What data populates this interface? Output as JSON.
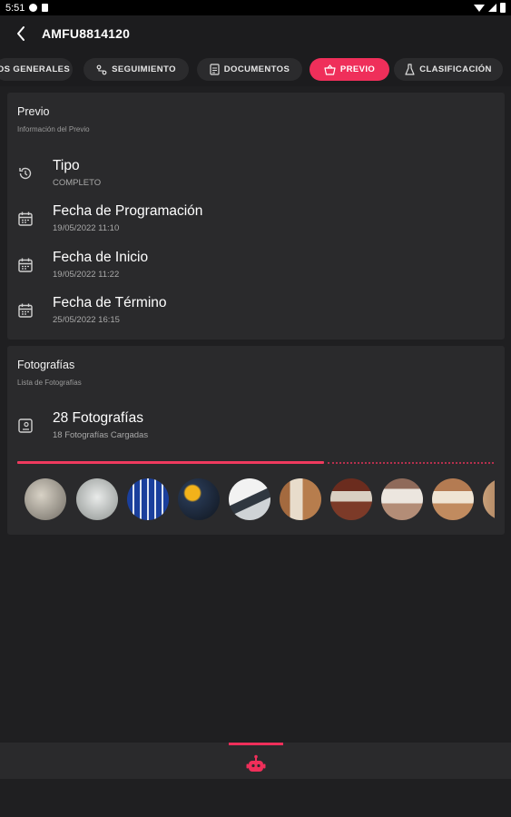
{
  "status_bar": {
    "time": "5:51"
  },
  "app_bar": {
    "title": "AMFU8814120",
    "back_icon": "arrow-back-icon"
  },
  "tabs": [
    {
      "label": "OS GENERALES",
      "icon": "",
      "active": false
    },
    {
      "label": "SEGUIMIENTO",
      "icon": "route-icon",
      "active": false
    },
    {
      "label": "DOCUMENTOS",
      "icon": "document-icon",
      "active": false
    },
    {
      "label": "PREVIO",
      "icon": "basket-icon",
      "active": true
    },
    {
      "label": "CLASIFICACIÓN",
      "icon": "flask-icon",
      "active": false
    }
  ],
  "previo": {
    "title": "Previo",
    "subtitle": "Información del Previo",
    "rows": [
      {
        "label": "Tipo",
        "value": "COMPLETO",
        "icon": "history-icon"
      },
      {
        "label": "Fecha de Programación",
        "value": "19/05/2022 11:10",
        "icon": "calendar-icon"
      },
      {
        "label": "Fecha de Inicio",
        "value": "19/05/2022 11:22",
        "icon": "calendar-icon"
      },
      {
        "label": "Fecha de Término",
        "value": "25/05/2022 16:15",
        "icon": "calendar-icon"
      }
    ]
  },
  "fotografias": {
    "title": "Fotografías",
    "subtitle": "Lista de Fotografías",
    "summary_label": "28 Fotografías",
    "summary_value": "18 Fotografías Cargadas",
    "summary_icon": "photo-album-icon",
    "progress_fraction": 0.643,
    "thumbnails": 10
  },
  "bottom_nav": {
    "icon": "robot-icon"
  },
  "colors": {
    "accent": "#ef2f5a",
    "background": "#1f1f21",
    "card": "#2a2a2c",
    "chip": "#2b2b2d"
  }
}
